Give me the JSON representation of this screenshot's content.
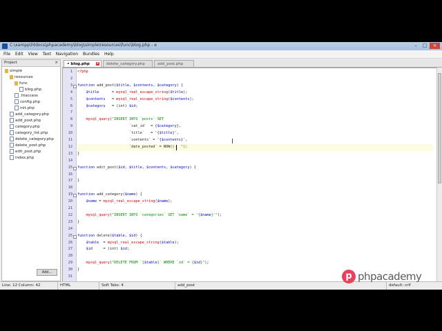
{
  "window": {
    "title": "C:\\xampp\\htdocs\\phpacademy\\blog\\simple\\resources\\func\\blog.php - e",
    "controls": [
      "–",
      "□",
      "×"
    ]
  },
  "menu": [
    "File",
    "Edit",
    "View",
    "Text",
    "Navigation",
    "Bundles",
    "Help"
  ],
  "project": {
    "header": "Project",
    "close": "×",
    "button": "Add...",
    "tree": [
      {
        "label": "simple",
        "kind": "folder",
        "depth": 0
      },
      {
        "label": "resources",
        "kind": "folder",
        "depth": 1
      },
      {
        "label": "func",
        "kind": "folder",
        "depth": 2
      },
      {
        "label": "blog.php",
        "kind": "file",
        "depth": 3
      },
      {
        "label": ".htaccess",
        "kind": "file",
        "depth": 2
      },
      {
        "label": "config.php",
        "kind": "file",
        "depth": 2
      },
      {
        "label": "init.php",
        "kind": "file",
        "depth": 2
      },
      {
        "label": "add_category.php",
        "kind": "file",
        "depth": 1
      },
      {
        "label": "add_post.php",
        "kind": "file",
        "depth": 1
      },
      {
        "label": "category.php",
        "kind": "file",
        "depth": 1
      },
      {
        "label": "category_list.php",
        "kind": "file",
        "depth": 1
      },
      {
        "label": "delete_category.php",
        "kind": "file",
        "depth": 1
      },
      {
        "label": "delete_post.php",
        "kind": "file",
        "depth": 1
      },
      {
        "label": "edit_post.php",
        "kind": "file",
        "depth": 1
      },
      {
        "label": "index.php",
        "kind": "file",
        "depth": 1
      }
    ]
  },
  "tabs": [
    {
      "label": "• blog.php",
      "active": true
    },
    {
      "label": "delete_category.php",
      "active": false
    },
    {
      "label": "add_post.php",
      "active": false
    }
  ],
  "editor": {
    "current_line": 12,
    "lines": [
      "<?php",
      "",
      "function add_post($title, $contents, $category) {",
      "    $title      = mysql_real_escape_string($title);",
      "    $contents   = mysql_real_escape_string($contents);",
      "    $category   = (int) $id;",
      "",
      "    mysql_query(\"INSERT INTO `posts` SET",
      "                        `cat_id`  = {$category},",
      "                        `title`   = '{$title}',",
      "                        `contents` = '{$contents}',",
      "                        `date_posted` = NOW()   \");",
      "}",
      "",
      "function edit_post($id, $title, $contents, $category) {",
      "",
      "}",
      "",
      "function add_category($name) {",
      "    $name = mysql_real_escape_string($name);",
      "",
      "    mysql_query(\"INSERT INTO `categories` SET `name` = '{$name}'\");",
      "}",
      "",
      "function delete($table, $id) {",
      "    $table  = mysql_real_escape_string($table);",
      "    $id     = (int) $id;",
      "",
      "    mysql_query(\"DELETE FROM `{$table}` WHERE `id` = {$id}\");",
      "}",
      ""
    ],
    "fold_lines": [
      3,
      15,
      19,
      25
    ]
  },
  "status": {
    "position": "Line: 12  Column: 42",
    "language": "HTML",
    "tabs": "Soft Tabs: 4",
    "symbol": "add_post",
    "encoding": "default: crlf"
  },
  "watermark": {
    "icon": "p",
    "text": "phpacademy"
  },
  "colors": {
    "keyword": "#0000cc",
    "variable": "#0000cc",
    "function": "#cc0000",
    "string": "#008800",
    "php_tag": "#cc0000",
    "gutter": "#e4e4f4",
    "logo": "#e8405e"
  }
}
